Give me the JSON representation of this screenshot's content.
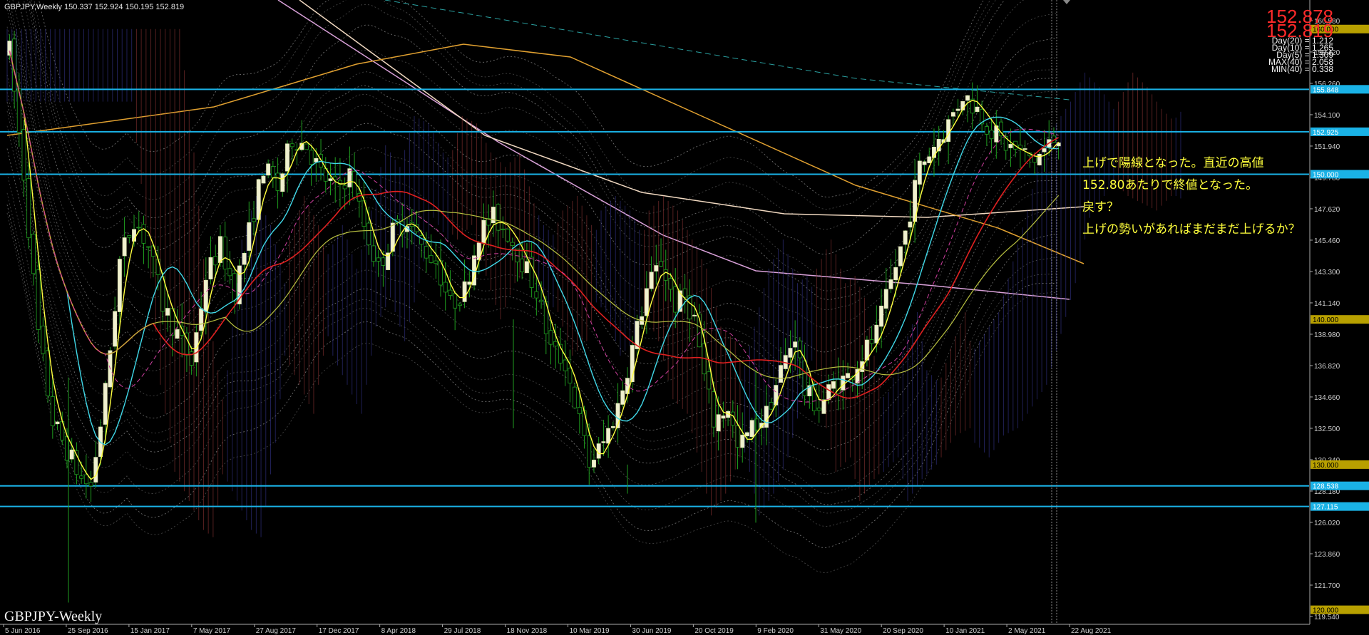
{
  "window": {
    "title_bar": "GBPJPY,Weekly  150.337 152.924 150.195 152.819",
    "watermark": "GBPJPY-Weekly"
  },
  "price_display": {
    "ask": "152.878",
    "bid": "152.819",
    "ask_color": "#ff2a2a",
    "bid_color": "#ff2a2a"
  },
  "stats": [
    "Day(20) = 1.212",
    "Day(10) = 1.265",
    "Day(5) = 1.309",
    "MAX(40) = 2.058",
    "MIN(40) = 0.338"
  ],
  "annotation": {
    "lines": [
      "上げで陽線となった。直近の高値",
      "152.80あたりで終値となった。",
      "戻す？",
      "上げの勢いがあればまだまだ上げるか？"
    ],
    "color": "#ffff3c"
  },
  "price_axis": {
    "ticks": [
      "160.580",
      "158.420",
      "156.260",
      "154.100",
      "151.940",
      "149.780",
      "147.620",
      "145.460",
      "143.300",
      "141.140",
      "138.980",
      "136.820",
      "134.660",
      "132.500",
      "130.340",
      "128.180",
      "126.020",
      "123.860",
      "121.700",
      "119.540"
    ],
    "tags": [
      {
        "label": "160.000",
        "value": 160.0,
        "color": "#b8a000"
      },
      {
        "label": "155.848",
        "value": 155.848,
        "color": "#1ab2e6"
      },
      {
        "label": "152.925",
        "value": 152.925,
        "color": "#1ab2e6"
      },
      {
        "label": "150.000",
        "value": 150.0,
        "color": "#1ab2e6"
      },
      {
        "label": "140.000",
        "value": 140.0,
        "color": "#b8a000"
      },
      {
        "label": "130.000",
        "value": 130.0,
        "color": "#b8a000"
      },
      {
        "label": "128.538",
        "value": 128.538,
        "color": "#1ab2e6"
      },
      {
        "label": "127.115",
        "value": 127.115,
        "color": "#1ab2e6"
      },
      {
        "label": "120.000",
        "value": 120.0,
        "color": "#b8a000"
      }
    ]
  },
  "date_axis": {
    "labels": [
      "5 Jun 2016",
      "25 Sep 2016",
      "15 Jan 2017",
      "7 May 2017",
      "27 Aug 2017",
      "17 Dec 2017",
      "8 Apr 2018",
      "29 Jul 2018",
      "18 Nov 2018",
      "10 Mar 2019",
      "30 Jun 2019",
      "20 Oct 2019",
      "9 Feb 2020",
      "31 May 2020",
      "20 Sep 2020",
      "10 Jan 2021",
      "2 May 2021",
      "22 Aug 2021"
    ]
  },
  "horizontal_lines": [
    {
      "value": 155.848,
      "color": "#1ab2e6"
    },
    {
      "value": 152.925,
      "color": "#1ab2e6"
    },
    {
      "value": 150.0,
      "color": "#1ab2e6"
    },
    {
      "value": 128.538,
      "color": "#1ab2e6"
    },
    {
      "value": 127.115,
      "color": "#1ab2e6"
    }
  ],
  "chart_data": {
    "type": "candlestick",
    "symbol": "GBPJPY",
    "timeframe": "Weekly",
    "ylim": [
      119.0,
      162.0
    ],
    "last": {
      "open": 150.337,
      "high": 152.924,
      "low": 150.195,
      "close": 152.819
    },
    "price_path": [
      [
        0,
        158.5
      ],
      [
        3,
        150.0
      ],
      [
        6,
        139.0
      ],
      [
        9,
        133.0
      ],
      [
        12,
        131.0
      ],
      [
        15,
        129.0
      ],
      [
        17,
        128.5
      ],
      [
        20,
        135.0
      ],
      [
        23,
        144.0
      ],
      [
        26,
        147.0
      ],
      [
        29,
        145.0
      ],
      [
        32,
        141.0
      ],
      [
        35,
        139.0
      ],
      [
        38,
        137.0
      ],
      [
        41,
        143.0
      ],
      [
        44,
        145.0
      ],
      [
        47,
        142.0
      ],
      [
        50,
        146.0
      ],
      [
        53,
        150.5
      ],
      [
        56,
        149.0
      ],
      [
        59,
        152.5
      ],
      [
        62,
        152.0
      ],
      [
        65,
        150.0
      ],
      [
        68,
        149.0
      ],
      [
        71,
        150.0
      ],
      [
        74,
        146.5
      ],
      [
        77,
        143.5
      ],
      [
        80,
        146.0
      ],
      [
        83,
        147.0
      ],
      [
        86,
        145.0
      ],
      [
        89,
        144.0
      ],
      [
        92,
        141.0
      ],
      [
        95,
        142.0
      ],
      [
        98,
        146.0
      ],
      [
        101,
        147.0
      ],
      [
        104,
        146.0
      ],
      [
        107,
        144.0
      ],
      [
        110,
        142.0
      ],
      [
        113,
        138.0
      ],
      [
        116,
        137.0
      ],
      [
        119,
        133.0
      ],
      [
        121,
        130.0
      ],
      [
        124,
        131.5
      ],
      [
        127,
        134.0
      ],
      [
        130,
        138.0
      ],
      [
        133,
        142.0
      ],
      [
        136,
        144.0
      ],
      [
        139,
        141.0
      ],
      [
        141,
        141.5
      ],
      [
        143,
        140.0
      ],
      [
        145,
        136.0
      ],
      [
        147,
        133.0
      ],
      [
        150,
        134.0
      ],
      [
        152,
        131.0
      ],
      [
        155,
        132.5
      ],
      [
        158,
        133.5
      ],
      [
        161,
        136.5
      ],
      [
        164,
        139.0
      ],
      [
        166,
        135.0
      ],
      [
        169,
        134.0
      ],
      [
        172,
        135.5
      ],
      [
        175,
        136.0
      ],
      [
        178,
        137.5
      ],
      [
        181,
        139.0
      ],
      [
        184,
        142.5
      ],
      [
        187,
        146.0
      ],
      [
        190,
        150.5
      ],
      [
        193,
        152.0
      ],
      [
        196,
        153.5
      ],
      [
        199,
        155.5
      ],
      [
        202,
        154.5
      ],
      [
        205,
        153.0
      ],
      [
        208,
        152.0
      ],
      [
        211,
        151.5
      ],
      [
        214,
        151.0
      ],
      [
        217,
        152.0
      ],
      [
        219,
        152.8
      ]
    ]
  }
}
